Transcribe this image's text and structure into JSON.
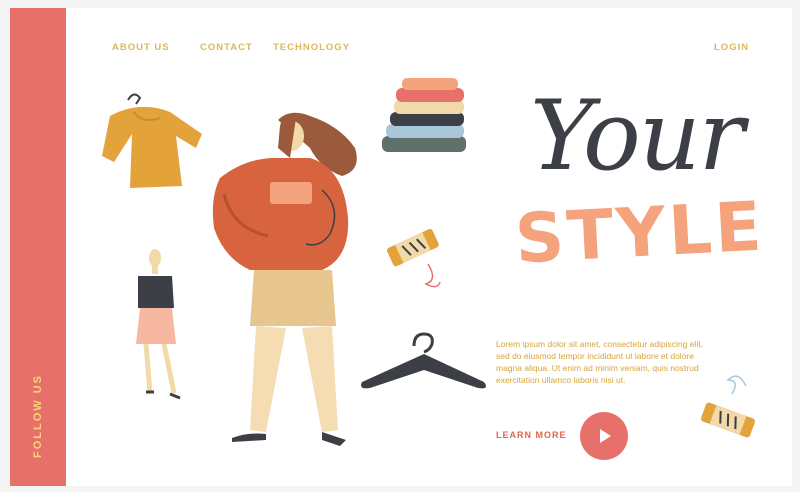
{
  "sidebar": {
    "follow_label": "FOLLOW US"
  },
  "nav": {
    "items": [
      {
        "label": "ABOUT US"
      },
      {
        "label": "CONTACT"
      },
      {
        "label": "TECHNOLOGY"
      }
    ],
    "login_label": "LOGIN"
  },
  "hero": {
    "title_line1": "Your",
    "title_line2": "STYLE",
    "body_text": "Lorem ipsum dolor sit amet, consectetur adipiscing elit, sed do eiusmod tempor incididunt ut labore et dolore magna aliqua. Ut enim ad minim veniam, quis nostrud exercitation ullamco laboris nisi ut.",
    "learn_more_label": "LEARN MORE"
  },
  "icons": {
    "play": "play-icon"
  },
  "colors": {
    "sidebar": "#e8706a",
    "nav_text": "#d9b95a",
    "title_dark": "#3c3f45",
    "title_accent": "#f4a37c",
    "cta": "#e0674b"
  }
}
